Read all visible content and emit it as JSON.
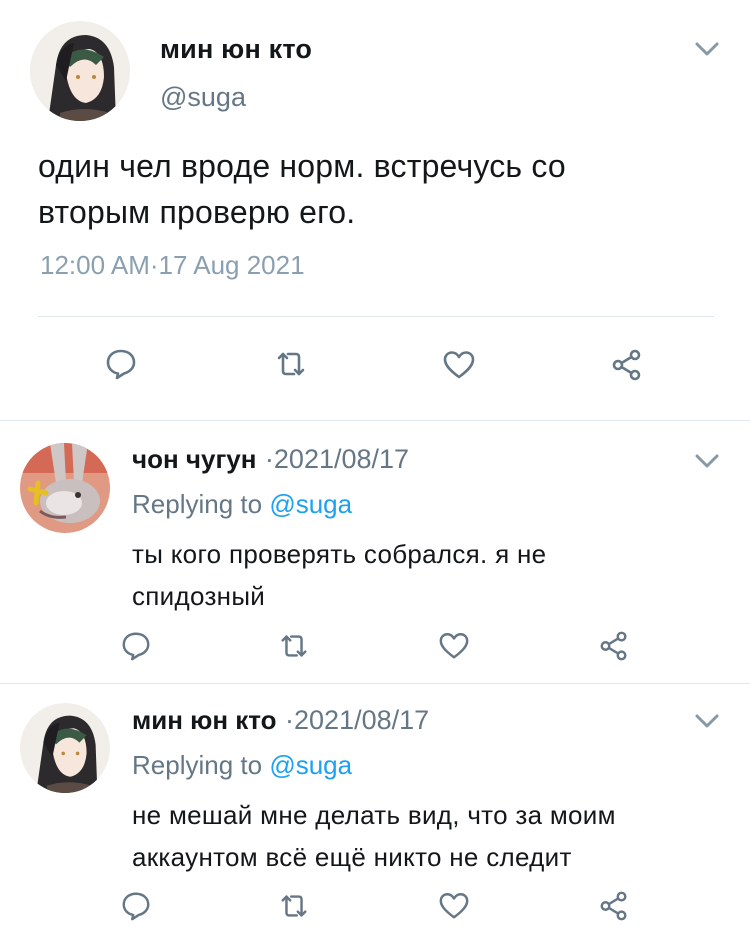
{
  "main_tweet": {
    "display_name": "мин юн кто",
    "handle": "@suga",
    "text_line1": "один чел вроде норм. встречусь со",
    "text_line2": "вторым проверю его.",
    "time": "12:00 AM",
    "date": "17 Aug 2021",
    "separator": "·"
  },
  "replies": [
    {
      "display_name": "чон чугун",
      "date": "2021/08/17",
      "separator": "·",
      "replying_label": "Replying to",
      "replying_to": "@suga",
      "text_line1": "ты кого проверять собрался. я не",
      "text_line2": "спидозный"
    },
    {
      "display_name": "мин юн кто",
      "date": "2021/08/17",
      "separator": "·",
      "replying_label": "Replying to",
      "replying_to": "@suga",
      "text_line1": "не мешай мне делать вид, что за моим",
      "text_line2": "аккаунтом всё ещё никто не следит"
    }
  ],
  "colors": {
    "accent": "#1da1f2",
    "icon": "#657786",
    "divider": "#e1e8ed"
  },
  "icons": [
    "chevron-down-icon",
    "reply-icon",
    "retweet-icon",
    "like-icon",
    "share-icon"
  ]
}
